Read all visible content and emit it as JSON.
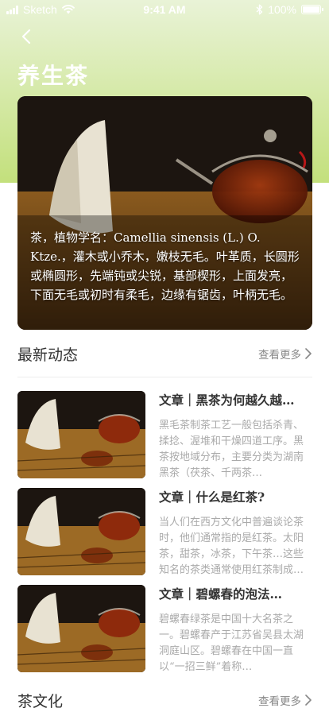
{
  "status_bar": {
    "carrier": "Sketch",
    "time": "9:41 AM",
    "battery": "100%",
    "battery_level": 1.0
  },
  "header": {
    "title": "养生茶",
    "back_icon": "chevron-left-icon"
  },
  "hero": {
    "description": "茶，植物学名：Camellia sinensis (L.) O. Ktze.，灌木或小乔木，嫩枝无毛。叶革质，长圆形或椭圆形，先端钝或尖锐，基部楔形，上面发亮，下面无毛或初时有柔毛，边缘有锯齿，叶柄无毛。"
  },
  "latest": {
    "title": "最新动态",
    "more_label": "查看更多",
    "articles": [
      {
        "title": "文章｜黑茶为何越久越…",
        "desc": "黑毛茶制茶工艺一般包括杀青、揉捻、渥堆和干燥四道工序。黑茶按地域分布，主要分类为湖南黑茶（茯茶、千两茶…"
      },
      {
        "title": "文章｜什么是红茶?",
        "desc": "当人们在西方文化中普遍谈论茶时，他们通常指的是红茶。太阳茶，甜茶，冰茶，下午茶…这些知名的茶类通常使用红茶制成…"
      },
      {
        "title": "文章｜碧螺春的泡法…",
        "desc": "碧螺春绿茶是中国十大名茶之一。碧螺春产于江苏省吴县太湖洞庭山区。碧螺春在中国一直以“一招三鲜”着称…"
      }
    ]
  },
  "culture": {
    "title": "茶文化",
    "more_label": "查看更多"
  },
  "colors": {
    "header_gradient_top": "#e9f3d7",
    "header_gradient_bottom": "#c3e07c"
  }
}
